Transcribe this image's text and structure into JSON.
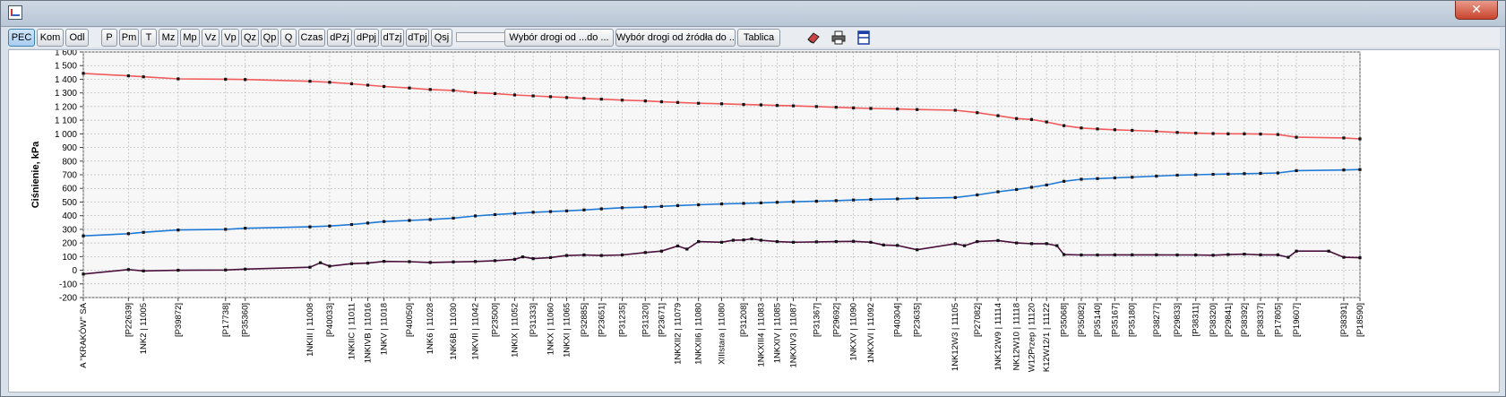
{
  "toolbar": {
    "buttons": [
      "PEC",
      "Kom",
      "Odl",
      "P",
      "Pm",
      "T",
      "Mz",
      "Mp",
      "Vz",
      "Vp",
      "Qz",
      "Qp",
      "Q",
      "Czas",
      "dPzj",
      "dPpj",
      "dTzj",
      "dTpj",
      "Qsj"
    ],
    "route_from_label": "Wybór drogi od ...do ...",
    "route_source_label": "Wybór drogi od źródła do ...",
    "table_label": "Tablica"
  },
  "icons": {
    "eraser": "eraser-icon",
    "print": "printer-icon",
    "layout": "layout-icon"
  },
  "window": {
    "close_glyph": "✕"
  },
  "chart_data": {
    "type": "line",
    "ylabel": "Ciśnienie, kPa",
    "ylim": [
      -200,
      1600
    ],
    "ytick_step": 100,
    "y_tick_labels": [
      "-200",
      "-100",
      "0",
      "100",
      "200",
      "300",
      "400",
      "500",
      "600",
      "700",
      "800",
      "900",
      "1 000",
      "1 100",
      "1 200",
      "1 300",
      "1 400",
      "1 500",
      "1 600"
    ],
    "grid": true,
    "x_labels": [
      {
        "t": 0.0,
        "label": "A \"KRAKÓW\" SA"
      },
      {
        "t": 0.039,
        "label": "[P22639]"
      },
      {
        "t": 0.052,
        "label": "1NK2 | 11005"
      },
      {
        "t": 0.082,
        "label": "[P39872]"
      },
      {
        "t": 0.123,
        "label": "[P17738]"
      },
      {
        "t": 0.14,
        "label": "[P35360]"
      },
      {
        "t": 0.196,
        "label": "1NKIII | 11008"
      },
      {
        "t": 0.213,
        "label": "[P40033]"
      },
      {
        "t": 0.232,
        "label": "1NKIIC | 11011"
      },
      {
        "t": 0.246,
        "label": "1NKIVB | 11016"
      },
      {
        "t": 0.26,
        "label": "1NKV | 11018"
      },
      {
        "t": 0.282,
        "label": "[P40050]"
      },
      {
        "t": 0.3,
        "label": "1NK6 | 11028"
      },
      {
        "t": 0.32,
        "label": "1NK6B | 11030"
      },
      {
        "t": 0.339,
        "label": "1NKVII | 11042"
      },
      {
        "t": 0.356,
        "label": "[P23500]"
      },
      {
        "t": 0.373,
        "label": "1NKIX | 11052"
      },
      {
        "t": 0.389,
        "label": "[P31333]"
      },
      {
        "t": 0.404,
        "label": "1NKX | 11060"
      },
      {
        "t": 0.418,
        "label": "1NKXI | 11065"
      },
      {
        "t": 0.433,
        "label": "[P32885]"
      },
      {
        "t": 0.448,
        "label": "[P23651]"
      },
      {
        "t": 0.466,
        "label": "[P31235]"
      },
      {
        "t": 0.486,
        "label": "[P31320]"
      },
      {
        "t": 0.5,
        "label": "[P23671]"
      },
      {
        "t": 0.514,
        "label": "1NKXII2 | 11079"
      },
      {
        "t": 0.532,
        "label": "1NKXII6 | 11080"
      },
      {
        "t": 0.552,
        "label": "XIIIstara | 11080"
      },
      {
        "t": 0.571,
        "label": "[P31208]"
      },
      {
        "t": 0.586,
        "label": "1NKXIII4 | 11083"
      },
      {
        "t": 0.6,
        "label": "1NKXIV | 11085"
      },
      {
        "t": 0.614,
        "label": "1NKXIV3 | 11087"
      },
      {
        "t": 0.634,
        "label": "[P31367]"
      },
      {
        "t": 0.651,
        "label": "[P29692]"
      },
      {
        "t": 0.666,
        "label": "1NKXV | 11090"
      },
      {
        "t": 0.681,
        "label": "1NKXVI | 11092"
      },
      {
        "t": 0.704,
        "label": "[P40304]"
      },
      {
        "t": 0.721,
        "label": "[P23635]"
      },
      {
        "t": 0.754,
        "label": "1NK12W3 | 11105"
      },
      {
        "t": 0.773,
        "label": "[P27082]"
      },
      {
        "t": 0.791,
        "label": "1NK12W9 | 11114"
      },
      {
        "t": 0.807,
        "label": "NK12W10 | 11118"
      },
      {
        "t": 0.82,
        "label": "W12Przep | 11120"
      },
      {
        "t": 0.833,
        "label": "K12W12/1 | 11122"
      },
      {
        "t": 0.848,
        "label": "[P35068]"
      },
      {
        "t": 0.863,
        "label": "[P35082]"
      },
      {
        "t": 0.877,
        "label": "[P35140]"
      },
      {
        "t": 0.892,
        "label": "[P35167]"
      },
      {
        "t": 0.907,
        "label": "[P35180]"
      },
      {
        "t": 0.928,
        "label": "[P38277]"
      },
      {
        "t": 0.946,
        "label": "[P29833]"
      },
      {
        "t": 0.962,
        "label": "[P38311]"
      },
      {
        "t": 0.977,
        "label": "[P38320]"
      },
      {
        "t": 0.99,
        "label": "[P29841]"
      },
      {
        "t": 1.004,
        "label": "[P38392]"
      },
      {
        "t": 1.018,
        "label": "[P38337]"
      },
      {
        "t": 1.033,
        "label": "[P17805]"
      },
      {
        "t": 1.049,
        "label": "[P19607]"
      },
      {
        "t": 1.09,
        "label": "[P38391]"
      },
      {
        "t": 1.104,
        "label": "[P18590]"
      }
    ],
    "series": [
      {
        "color": "#f25b5b",
        "points": [
          [
            0,
            1443
          ],
          [
            0.039,
            1425
          ],
          [
            0.052,
            1418
          ],
          [
            0.082,
            1403
          ],
          [
            0.123,
            1400
          ],
          [
            0.14,
            1398
          ],
          [
            0.196,
            1385
          ],
          [
            0.213,
            1378
          ],
          [
            0.232,
            1367
          ],
          [
            0.246,
            1357
          ],
          [
            0.26,
            1347
          ],
          [
            0.282,
            1336
          ],
          [
            0.3,
            1325
          ],
          [
            0.32,
            1318
          ],
          [
            0.339,
            1302
          ],
          [
            0.356,
            1295
          ],
          [
            0.373,
            1285
          ],
          [
            0.389,
            1278
          ],
          [
            0.404,
            1272
          ],
          [
            0.418,
            1266
          ],
          [
            0.433,
            1260
          ],
          [
            0.448,
            1254
          ],
          [
            0.466,
            1247
          ],
          [
            0.486,
            1241
          ],
          [
            0.5,
            1235
          ],
          [
            0.514,
            1230
          ],
          [
            0.532,
            1224
          ],
          [
            0.552,
            1220
          ],
          [
            0.571,
            1215
          ],
          [
            0.586,
            1212
          ],
          [
            0.6,
            1208
          ],
          [
            0.614,
            1205
          ],
          [
            0.634,
            1200
          ],
          [
            0.651,
            1195
          ],
          [
            0.666,
            1190
          ],
          [
            0.681,
            1186
          ],
          [
            0.704,
            1182
          ],
          [
            0.721,
            1178
          ],
          [
            0.754,
            1173
          ],
          [
            0.773,
            1155
          ],
          [
            0.791,
            1133
          ],
          [
            0.807,
            1112
          ],
          [
            0.82,
            1105
          ],
          [
            0.833,
            1087
          ],
          [
            0.848,
            1060
          ],
          [
            0.863,
            1043
          ],
          [
            0.877,
            1036
          ],
          [
            0.892,
            1030
          ],
          [
            0.907,
            1025
          ],
          [
            0.928,
            1018
          ],
          [
            0.946,
            1010
          ],
          [
            0.962,
            1005
          ],
          [
            0.977,
            1002
          ],
          [
            0.99,
            1000
          ],
          [
            1.004,
            1000
          ],
          [
            1.018,
            998
          ],
          [
            1.033,
            995
          ],
          [
            1.049,
            975
          ],
          [
            1.09,
            970
          ],
          [
            1.104,
            963
          ]
        ]
      },
      {
        "color": "#1f7ad6",
        "points": [
          [
            0,
            252
          ],
          [
            0.039,
            268
          ],
          [
            0.052,
            278
          ],
          [
            0.082,
            295
          ],
          [
            0.123,
            300
          ],
          [
            0.14,
            308
          ],
          [
            0.196,
            318
          ],
          [
            0.213,
            324
          ],
          [
            0.232,
            335
          ],
          [
            0.246,
            346
          ],
          [
            0.26,
            357
          ],
          [
            0.282,
            365
          ],
          [
            0.3,
            372
          ],
          [
            0.32,
            382
          ],
          [
            0.339,
            398
          ],
          [
            0.356,
            408
          ],
          [
            0.373,
            416
          ],
          [
            0.389,
            425
          ],
          [
            0.404,
            430
          ],
          [
            0.418,
            435
          ],
          [
            0.433,
            442
          ],
          [
            0.448,
            450
          ],
          [
            0.466,
            458
          ],
          [
            0.486,
            463
          ],
          [
            0.5,
            468
          ],
          [
            0.514,
            474
          ],
          [
            0.532,
            480
          ],
          [
            0.552,
            486
          ],
          [
            0.571,
            490
          ],
          [
            0.586,
            494
          ],
          [
            0.6,
            498
          ],
          [
            0.614,
            502
          ],
          [
            0.634,
            506
          ],
          [
            0.651,
            510
          ],
          [
            0.666,
            515
          ],
          [
            0.681,
            519
          ],
          [
            0.704,
            523
          ],
          [
            0.721,
            527
          ],
          [
            0.754,
            533
          ],
          [
            0.773,
            552
          ],
          [
            0.791,
            575
          ],
          [
            0.807,
            592
          ],
          [
            0.82,
            608
          ],
          [
            0.833,
            625
          ],
          [
            0.848,
            652
          ],
          [
            0.863,
            667
          ],
          [
            0.877,
            672
          ],
          [
            0.892,
            677
          ],
          [
            0.907,
            682
          ],
          [
            0.928,
            690
          ],
          [
            0.946,
            697
          ],
          [
            0.962,
            700
          ],
          [
            0.977,
            703
          ],
          [
            0.99,
            705
          ],
          [
            1.004,
            708
          ],
          [
            1.018,
            710
          ],
          [
            1.033,
            713
          ],
          [
            1.049,
            730
          ],
          [
            1.09,
            735
          ],
          [
            1.104,
            738
          ]
        ]
      },
      {
        "color": "#4a0f3c",
        "points": [
          [
            0,
            -28
          ],
          [
            0.039,
            5
          ],
          [
            0.052,
            -5
          ],
          [
            0.082,
            0
          ],
          [
            0.123,
            2
          ],
          [
            0.14,
            8
          ],
          [
            0.196,
            22
          ],
          [
            0.205,
            55
          ],
          [
            0.213,
            30
          ],
          [
            0.232,
            48
          ],
          [
            0.246,
            52
          ],
          [
            0.26,
            65
          ],
          [
            0.282,
            63
          ],
          [
            0.3,
            57
          ],
          [
            0.32,
            61
          ],
          [
            0.339,
            64
          ],
          [
            0.356,
            70
          ],
          [
            0.373,
            80
          ],
          [
            0.38,
            98
          ],
          [
            0.389,
            85
          ],
          [
            0.404,
            93
          ],
          [
            0.418,
            108
          ],
          [
            0.433,
            112
          ],
          [
            0.448,
            108
          ],
          [
            0.466,
            112
          ],
          [
            0.486,
            130
          ],
          [
            0.5,
            140
          ],
          [
            0.514,
            178
          ],
          [
            0.522,
            155
          ],
          [
            0.532,
            210
          ],
          [
            0.552,
            205
          ],
          [
            0.562,
            220
          ],
          [
            0.571,
            222
          ],
          [
            0.578,
            230
          ],
          [
            0.586,
            220
          ],
          [
            0.6,
            210
          ],
          [
            0.614,
            205
          ],
          [
            0.634,
            208
          ],
          [
            0.651,
            210
          ],
          [
            0.666,
            212
          ],
          [
            0.681,
            205
          ],
          [
            0.692,
            185
          ],
          [
            0.704,
            182
          ],
          [
            0.721,
            150
          ],
          [
            0.754,
            195
          ],
          [
            0.762,
            180
          ],
          [
            0.773,
            210
          ],
          [
            0.791,
            218
          ],
          [
            0.807,
            200
          ],
          [
            0.82,
            195
          ],
          [
            0.833,
            195
          ],
          [
            0.842,
            180
          ],
          [
            0.848,
            115
          ],
          [
            0.863,
            112
          ],
          [
            0.877,
            112
          ],
          [
            0.892,
            113
          ],
          [
            0.907,
            113
          ],
          [
            0.928,
            113
          ],
          [
            0.946,
            112
          ],
          [
            0.962,
            112
          ],
          [
            0.977,
            110
          ],
          [
            0.99,
            115
          ],
          [
            1.004,
            118
          ],
          [
            1.018,
            113
          ],
          [
            1.033,
            113
          ],
          [
            1.042,
            95
          ],
          [
            1.049,
            140
          ],
          [
            1.077,
            140
          ],
          [
            1.09,
            95
          ],
          [
            1.104,
            92
          ]
        ]
      }
    ]
  }
}
